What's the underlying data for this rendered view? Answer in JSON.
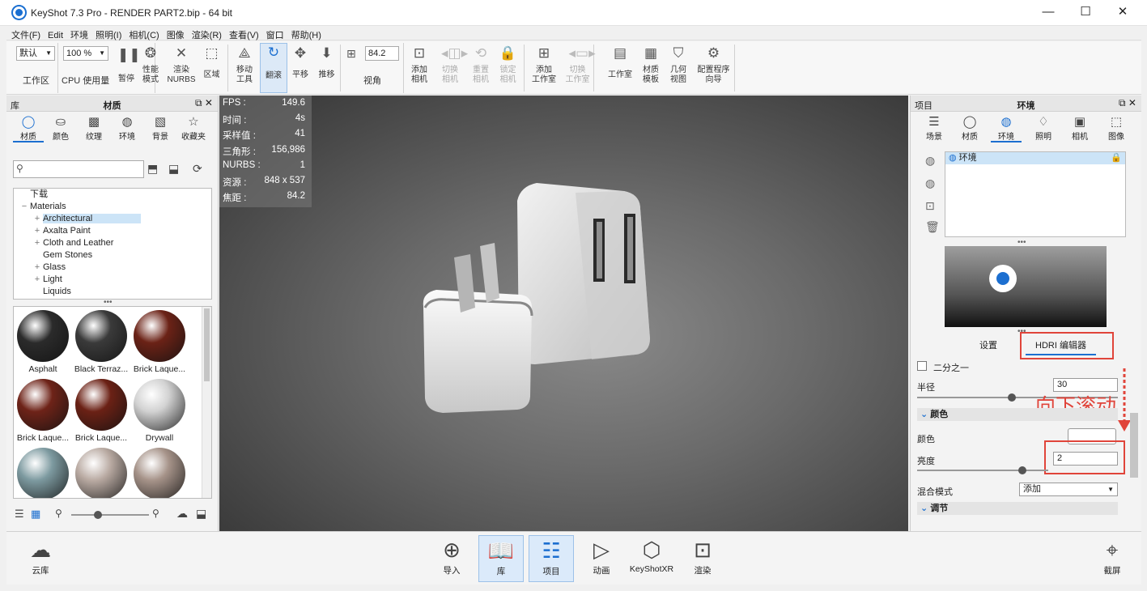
{
  "window": {
    "title": "KeyShot 7.3 Pro  -  RENDER PART2.bip  -  64 bit",
    "minimize": "—",
    "maximize": "☐",
    "close": "✕"
  },
  "menu": [
    "文件(F)",
    "Edit",
    "环境",
    "照明(I)",
    "相机(C)",
    "图像",
    "渲染(R)",
    "查看(V)",
    "窗口",
    "帮助(H)"
  ],
  "toolbar": {
    "workspace_value": "默认",
    "workspace_label": "工作区",
    "cpu_value": "100 %",
    "cpu_label": "CPU 使用量",
    "pause": "暂停",
    "perf_mode": "性能\n模式",
    "render_nurbs": "渲染\nNURBS",
    "region": "区域",
    "move_tool": "移动\n工具",
    "tumble": "翻滚",
    "pan": "平移",
    "dolly": "推移",
    "fov_value": "84.2",
    "fov_label": "视角",
    "add_camera": "添加\n相机",
    "switch_camera": "切换\n相机",
    "reset_camera": "重置\n相机",
    "lock_camera": "锁定\n相机",
    "add_studio": "添加\n工作室",
    "switch_studio": "切换\n工作室",
    "studio": "工作室",
    "material_template": "材质\n模板",
    "geometry_view": "几何\n视图",
    "config_wizard": "配置程序\n向导"
  },
  "library": {
    "header_left": "库",
    "header_title": "材质",
    "tabs": [
      "材质",
      "颜色",
      "纹理",
      "环境",
      "背景",
      "收藏夹"
    ],
    "search_placeholder": "",
    "tree": [
      {
        "label": "下载",
        "level": 0,
        "expand": ""
      },
      {
        "label": "Materials",
        "level": 0,
        "expand": "−"
      },
      {
        "label": "Architectural",
        "level": 1,
        "expand": "+",
        "selected": true
      },
      {
        "label": "Axalta Paint",
        "level": 1,
        "expand": "+"
      },
      {
        "label": "Cloth and Leather",
        "level": 1,
        "expand": "+"
      },
      {
        "label": "Gem Stones",
        "level": 1,
        "expand": ""
      },
      {
        "label": "Glass",
        "level": 1,
        "expand": "+"
      },
      {
        "label": "Light",
        "level": 1,
        "expand": "+"
      },
      {
        "label": "Liquids",
        "level": 1,
        "expand": ""
      }
    ],
    "thumbnails": [
      {
        "label": "Asphalt",
        "color": "#2b2b2b"
      },
      {
        "label": "Black Terraz...",
        "color": "#3a3a3a"
      },
      {
        "label": "Brick Laque...",
        "color": "#6b2216"
      },
      {
        "label": "Brick Laque...",
        "color": "#6e2318"
      },
      {
        "label": "Brick Laque...",
        "color": "#6b2115"
      },
      {
        "label": "Drywall",
        "color": "#d2d2d2"
      },
      {
        "label": "",
        "color": "#7d9aa0"
      },
      {
        "label": "",
        "color": "#b9aaa2"
      },
      {
        "label": "",
        "color": "#a69389"
      }
    ]
  },
  "viewport": {
    "hud": [
      {
        "k": "FPS :",
        "v": "149.6"
      },
      {
        "k": "时间 :",
        "v": "4s"
      },
      {
        "k": "采样值 :",
        "v": "41"
      },
      {
        "k": "三角形 :",
        "v": "156,986"
      },
      {
        "k": "NURBS :",
        "v": "1"
      },
      {
        "k": "资源 :",
        "v": "848 x 537"
      },
      {
        "k": "焦距 :",
        "v": "84.2"
      }
    ]
  },
  "project": {
    "header_left": "项目",
    "header_title": "环境",
    "tabs": [
      "场景",
      "材质",
      "环境",
      "照明",
      "相机",
      "图像"
    ],
    "env_item": "环境",
    "subtabs": [
      "设置",
      "HDRI 编辑器"
    ],
    "half_label": "二分之一",
    "radius_label": "半径",
    "radius_value": "30",
    "radius_level": 0.47,
    "color_section": "颜色",
    "color_label": "颜色",
    "brightness_label": "亮度",
    "brightness_value": "2",
    "brightness_level": 0.8,
    "blend_label": "混合模式",
    "blend_value": "添加",
    "adjust_section": "调节",
    "annotation": "向下滚动"
  },
  "bottom": {
    "cloud_library": "云库",
    "import": "导入",
    "library": "库",
    "project": "项目",
    "animation": "动画",
    "keyshotxr": "KeyShotXR",
    "render": "渲染",
    "screenshot": "截屏"
  },
  "colors": {
    "accent": "#1c6fd0",
    "annotation": "#e0443a"
  }
}
